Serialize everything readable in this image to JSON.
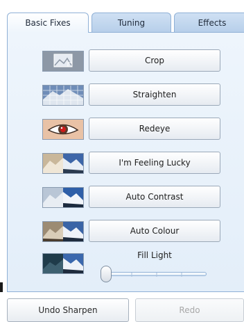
{
  "tabs": [
    {
      "label": "Basic Fixes",
      "active": true
    },
    {
      "label": "Tuning",
      "active": false
    },
    {
      "label": "Effects",
      "active": false
    }
  ],
  "fixes": [
    {
      "label": "Crop",
      "icon": "crop-thumbnail-icon"
    },
    {
      "label": "Straighten",
      "icon": "straighten-thumbnail-icon"
    },
    {
      "label": "Redeye",
      "icon": "redeye-thumbnail-icon"
    },
    {
      "label": "I'm Feeling Lucky",
      "icon": "feeling-lucky-thumbnail-icon"
    },
    {
      "label": "Auto Contrast",
      "icon": "auto-contrast-thumbnail-icon"
    },
    {
      "label": "Auto Colour",
      "icon": "auto-colour-thumbnail-icon"
    }
  ],
  "fill_light": {
    "label": "Fill Light",
    "value": 0
  },
  "bottom": {
    "undo_label": "Undo Sharpen",
    "redo_label": "Redo",
    "redo_enabled": false
  },
  "colors": {
    "accent": "#8fb0d6",
    "panel": "#eef5fc",
    "tab_inactive": "#c3d7ee"
  }
}
